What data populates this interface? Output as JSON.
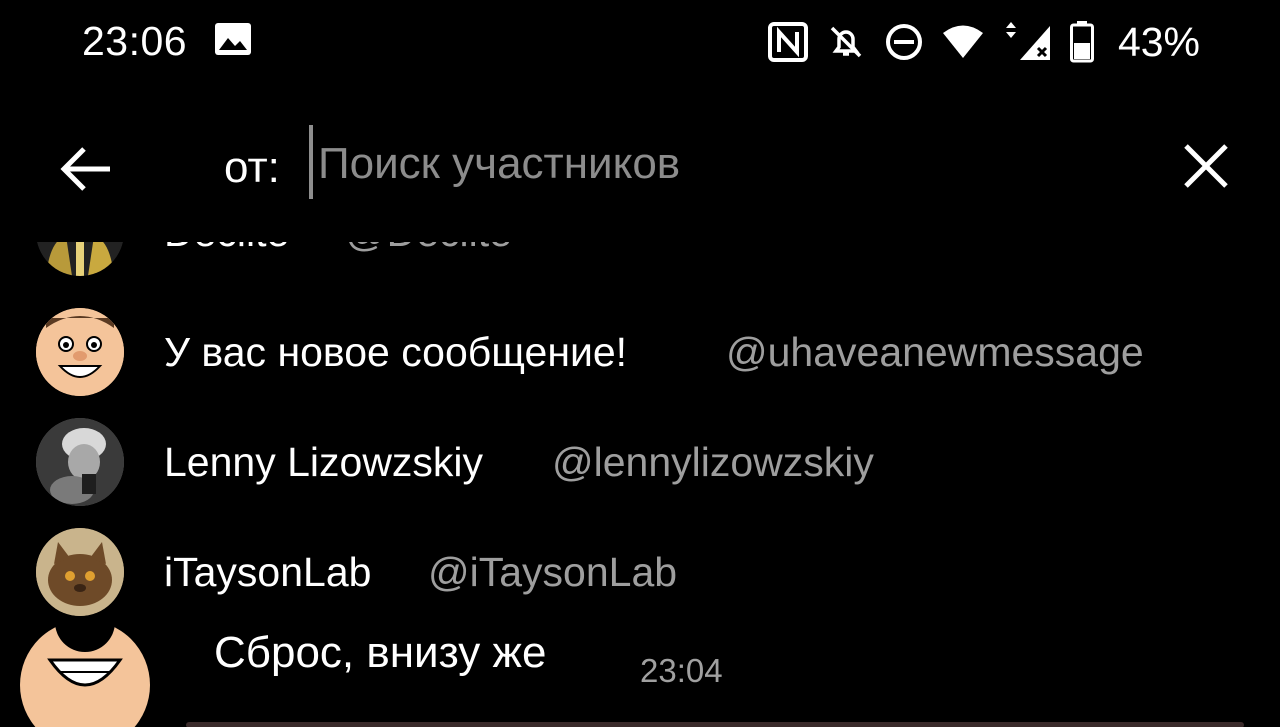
{
  "status_bar": {
    "time": "23:06",
    "battery_percent": "43%",
    "icons": [
      "gallery-icon",
      "nfc-icon",
      "bell-off-icon",
      "do-not-disturb-icon",
      "wifi-icon",
      "mobile-signal-icon",
      "battery-icon"
    ]
  },
  "search": {
    "prefix": "от:",
    "placeholder": "Поиск участников",
    "value": ""
  },
  "results": [
    {
      "name": "Decilte",
      "handle": "@Decilte"
    },
    {
      "name": "У вас новое сообщение!",
      "handle": "@uhaveanewmessage"
    },
    {
      "name": "Lenny Lizowzskiy",
      "handle": "@lennylizowzskiy"
    },
    {
      "name": "iTaysonLab",
      "handle": "@iTaysonLab"
    }
  ],
  "background_message": {
    "text": "Сброс, внизу же",
    "time": "23:04"
  },
  "colors": {
    "background": "#000000",
    "text_primary": "#ffffff",
    "text_secondary": "#9e9e9e",
    "avatar_face": "#f4c49a"
  }
}
